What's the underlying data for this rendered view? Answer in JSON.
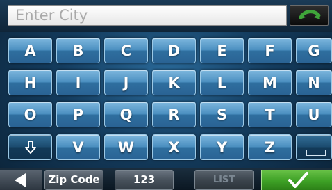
{
  "input": {
    "placeholder": "Enter City",
    "value": ""
  },
  "keyboard": {
    "rows": [
      [
        "A",
        "B",
        "C",
        "D",
        "E",
        "F",
        "G"
      ],
      [
        "H",
        "I",
        "J",
        "K",
        "L",
        "M",
        "N"
      ],
      [
        "O",
        "P",
        "Q",
        "R",
        "S",
        "T",
        "U"
      ],
      [
        "V",
        "W",
        "X",
        "Y",
        "Z"
      ]
    ]
  },
  "bottom": {
    "zip_label": "Zip Code",
    "num_label": "123",
    "list_label": "LIST"
  },
  "icons": {
    "back": "back-arrow-icon",
    "shift": "shift-arrow-icon",
    "space": "space-bar-icon",
    "prev": "left-arrow-icon",
    "ok": "checkmark-icon"
  }
}
